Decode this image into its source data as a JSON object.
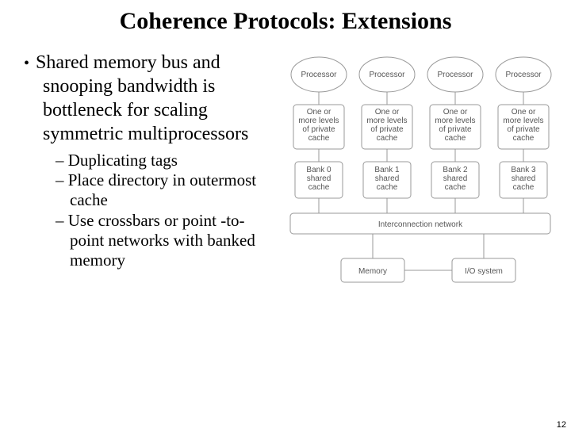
{
  "title": "Coherence Protocols:  Extensions",
  "bullet": "Shared memory bus and snooping bandwidth is bottleneck for scaling symmetric multiprocessors",
  "sub1": "Duplicating tags",
  "sub2": "Place directory in outermost cache",
  "sub3": "Use crossbars or point -to-point networks with banked memory",
  "diagram": {
    "proc": "Processor",
    "cache": "One or\nmore levels\nof private\ncache",
    "bank0": "Bank 0\nshared\ncache",
    "bank1": "Bank 1\nshared\ncache",
    "bank2": "Bank 2\nshared\ncache",
    "bank3": "Bank 3\nshared\ncache",
    "interconnect": "Interconnection network",
    "memory": "Memory",
    "io": "I/O system"
  },
  "page": "12"
}
